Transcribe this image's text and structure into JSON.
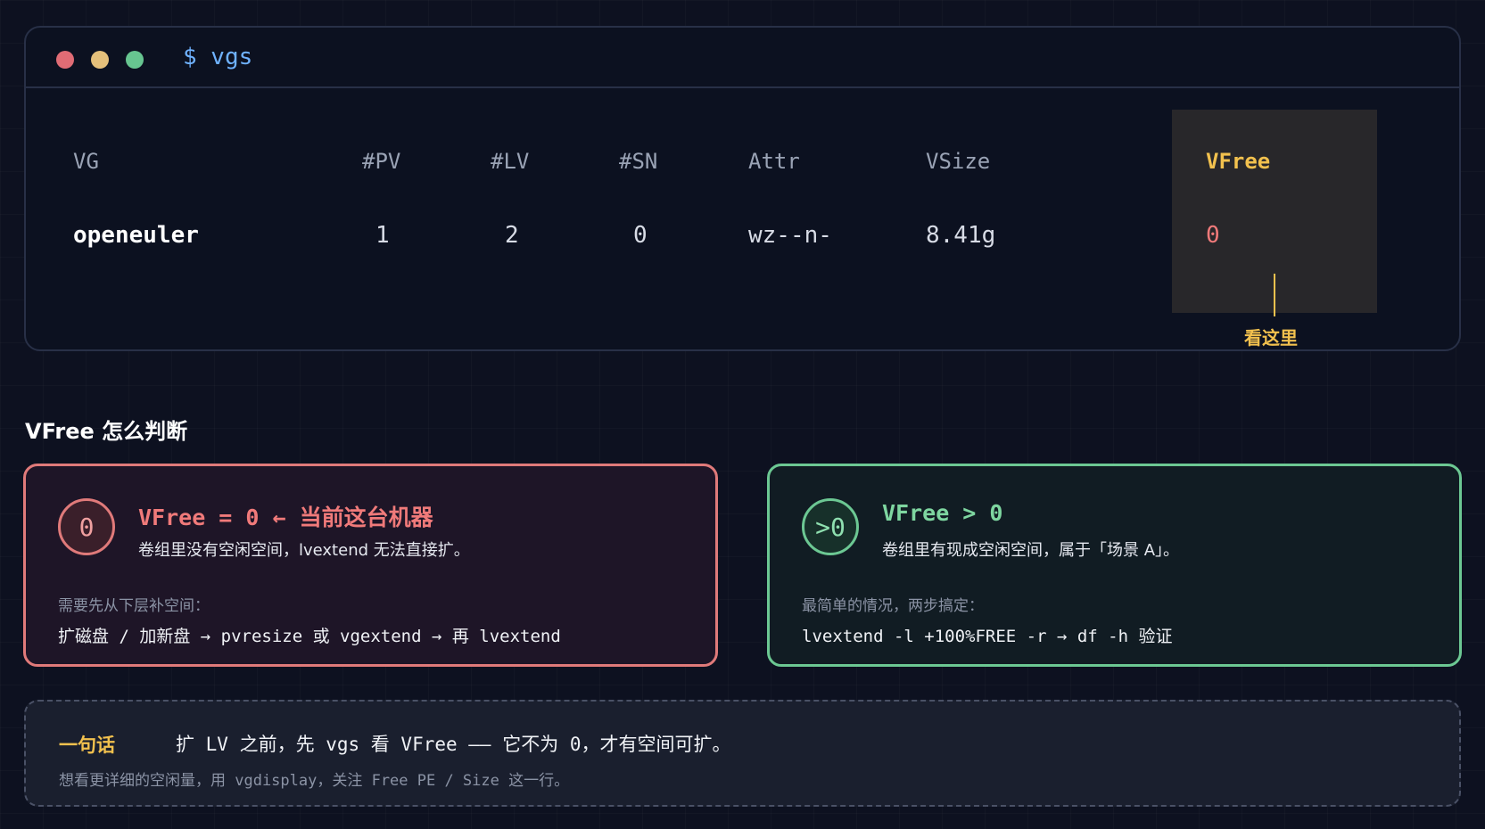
{
  "terminal": {
    "command": "$ vgs",
    "colors": {
      "dot_red": "#e06c75",
      "dot_yellow": "#e5c07b",
      "dot_green": "#67c590",
      "command": "#6fb2ff"
    },
    "headers": [
      "VG",
      "#PV",
      "#LV",
      "#SN",
      "Attr",
      "VSize",
      "VFree"
    ],
    "row": [
      "openeuler",
      "1",
      "2",
      "0",
      "wz--n-",
      "8.41g",
      "0"
    ],
    "highlight_column": "VFree",
    "pointer_label": "看这里"
  },
  "section": {
    "title": "VFree 怎么判断"
  },
  "cards": {
    "zero": {
      "badge": "0",
      "title": "VFree = 0  ← 当前这台机器",
      "subtitle": "卷组里没有空闲空间，lvextend 无法直接扩。",
      "note": "需要先从下层补空间：",
      "command": "扩磁盘 / 加新盘 → pvresize 或 vgextend → 再 lvextend",
      "color": "#e07a7a"
    },
    "positive": {
      "badge": ">0",
      "title": "VFree > 0",
      "subtitle": "卷组里有现成空闲空间，属于「场景 A」。",
      "note": "最简单的情况，两步搞定：",
      "command": "lvextend -l +100%FREE -r  →  df -h 验证",
      "color": "#6cc893"
    }
  },
  "summary": {
    "label": "一句话",
    "text": "扩 LV 之前，先 vgs 看 VFree —— 它不为 0，才有空间可扩。",
    "sub": "想看更详细的空闲量，用 vgdisplay，关注 Free PE / Size 这一行。"
  }
}
